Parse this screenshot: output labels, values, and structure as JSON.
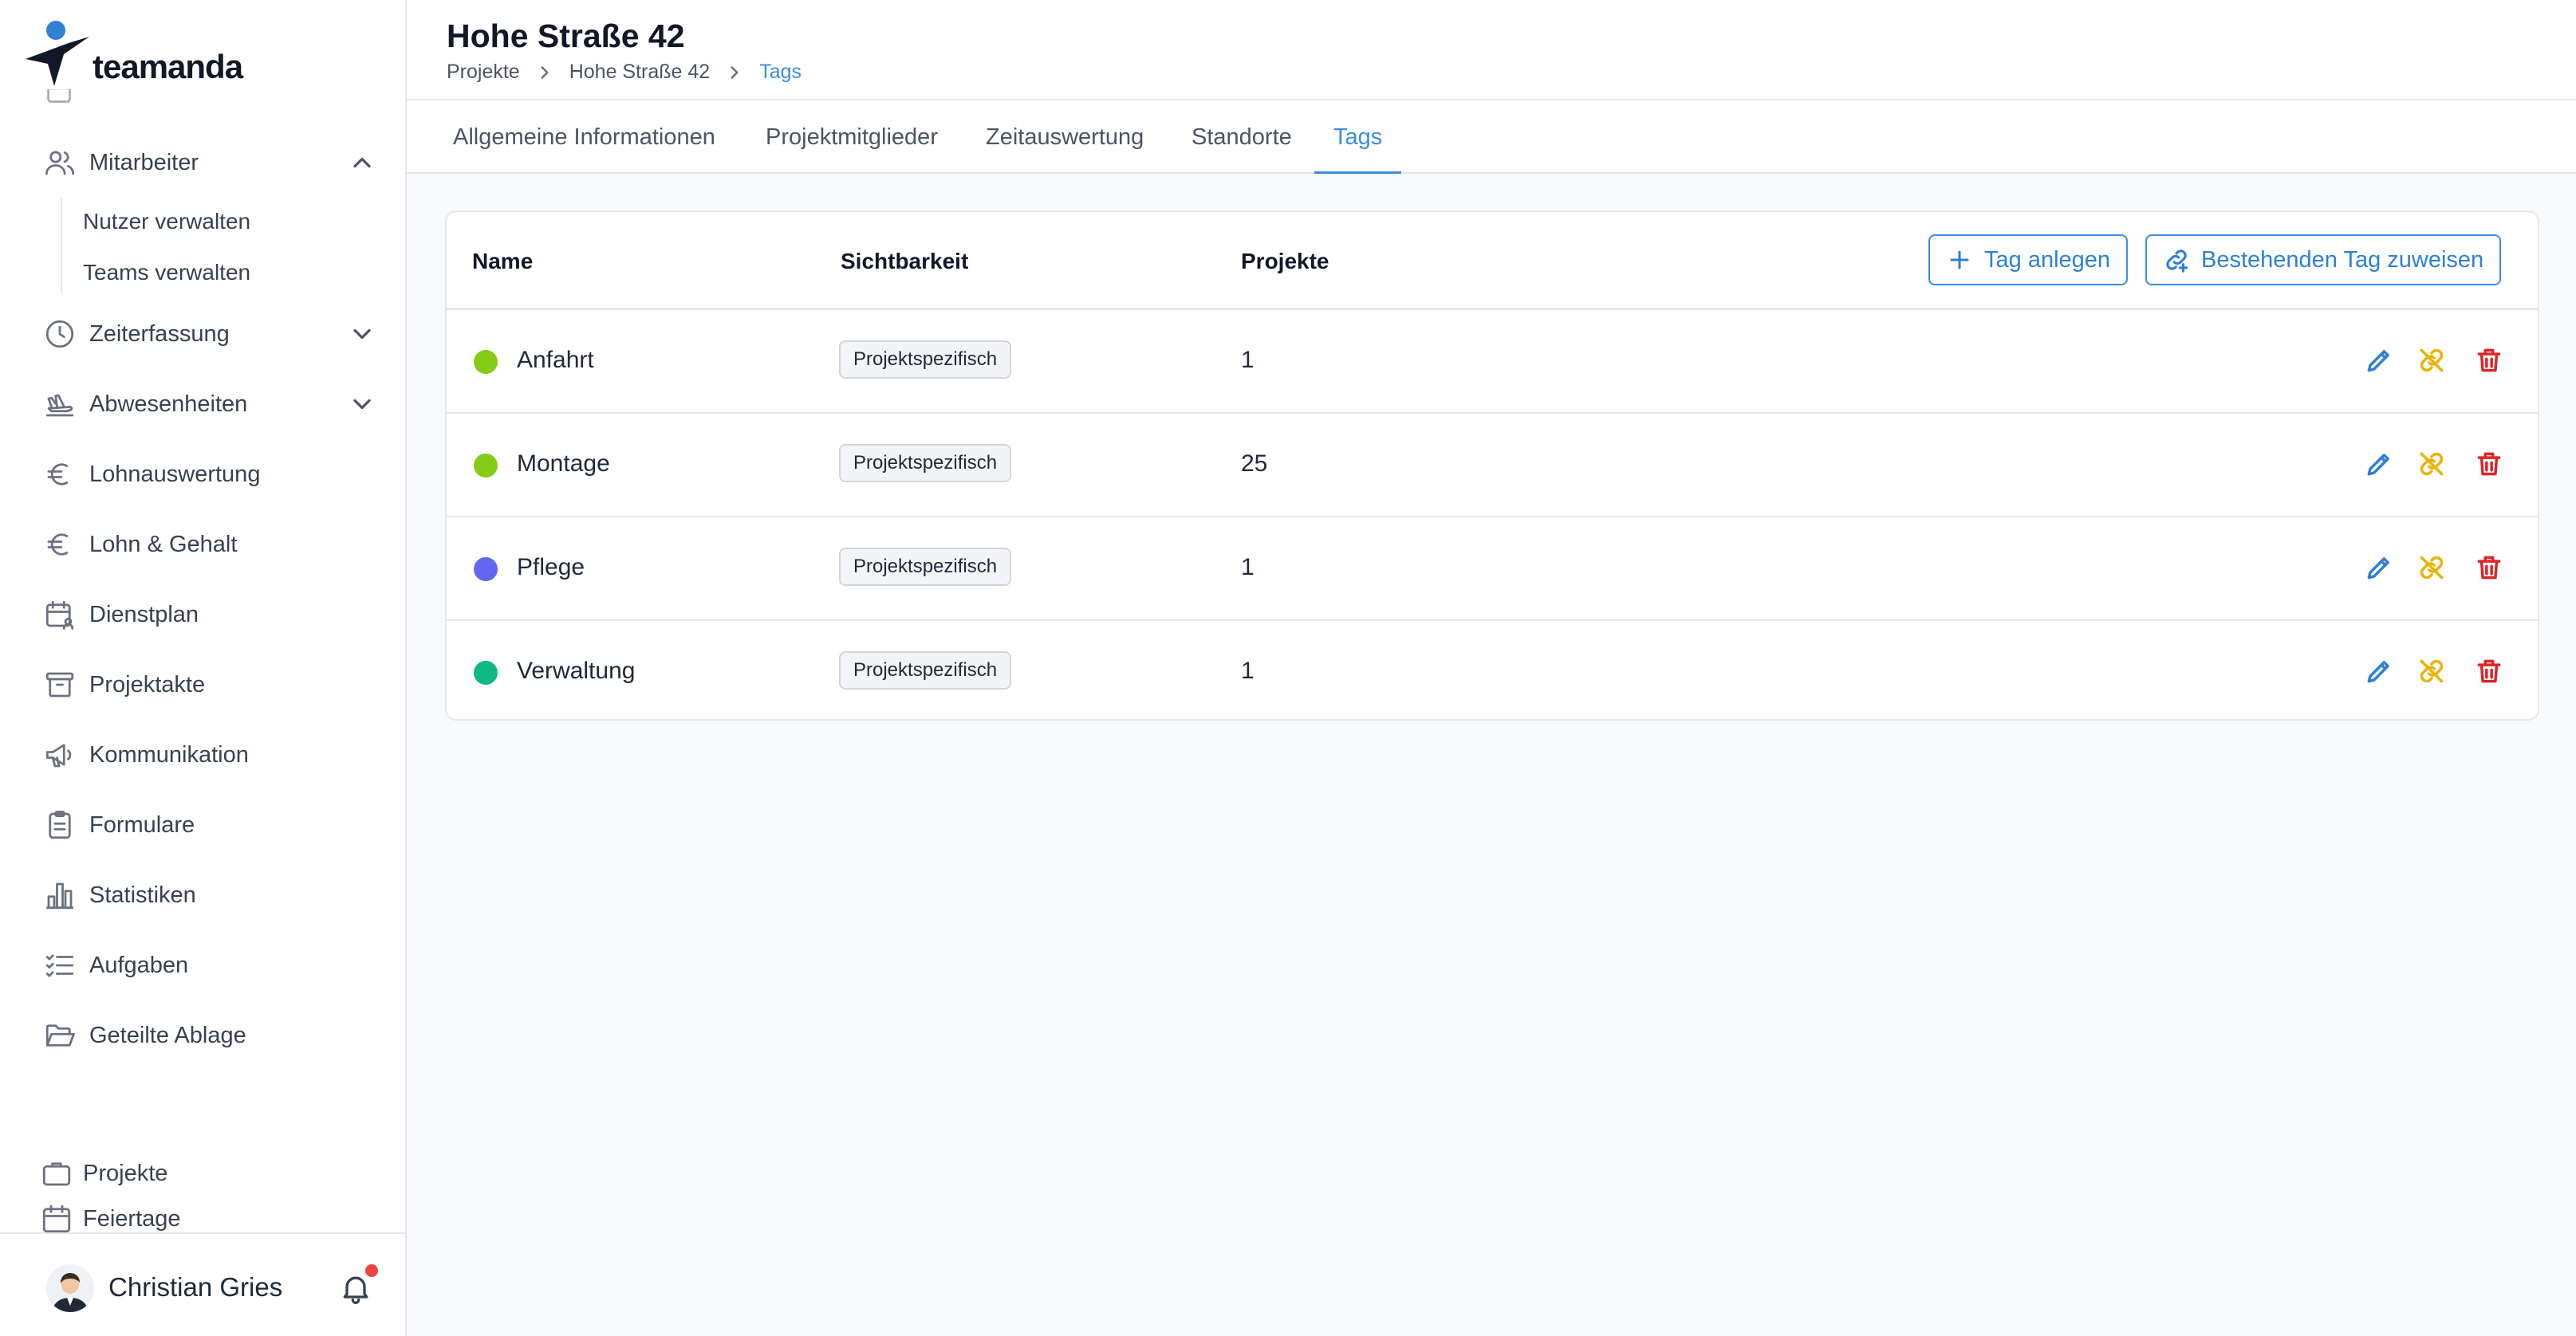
{
  "app": {
    "brand": "teamanda"
  },
  "sidebar": {
    "items": [
      {
        "label": "Mitarbeiter",
        "icon": "users-icon",
        "expanded": true
      },
      {
        "label": "Zeiterfassung",
        "icon": "clock-icon",
        "expanded": false
      },
      {
        "label": "Abwesenheiten",
        "icon": "plane-icon",
        "expanded": false
      },
      {
        "label": "Lohnauswertung",
        "icon": "euro-icon"
      },
      {
        "label": "Lohn & Gehalt",
        "icon": "euro-icon"
      },
      {
        "label": "Dienstplan",
        "icon": "calendar-user-icon"
      },
      {
        "label": "Projektakte",
        "icon": "archive-icon"
      },
      {
        "label": "Kommunikation",
        "icon": "megaphone-icon"
      },
      {
        "label": "Formulare",
        "icon": "clipboard-icon"
      },
      {
        "label": "Statistiken",
        "icon": "bar-chart-icon"
      },
      {
        "label": "Aufgaben",
        "icon": "checklist-icon"
      },
      {
        "label": "Geteilte Ablage",
        "icon": "folder-open-icon"
      }
    ],
    "subitems": [
      "Nutzer verwalten",
      "Teams verwalten"
    ],
    "bottom_items": [
      {
        "label": "Projekte",
        "icon": "briefcase-icon"
      },
      {
        "label": "Feiertage",
        "icon": "calendar-icon"
      }
    ],
    "user": {
      "name": "Christian Gries",
      "has_notification": true
    }
  },
  "header": {
    "title": "Hohe Straße 42",
    "breadcrumb": [
      "Projekte",
      "Hohe Straße 42",
      "Tags"
    ]
  },
  "tabs": [
    {
      "label": "Allgemeine Informationen",
      "active": false
    },
    {
      "label": "Projektmitglieder",
      "active": false
    },
    {
      "label": "Zeitauswertung",
      "active": false
    },
    {
      "label": "Standorte",
      "active": false
    },
    {
      "label": "Tags",
      "active": true
    }
  ],
  "table": {
    "columns": [
      "Name",
      "Sichtbarkeit",
      "Projekte"
    ],
    "buttons": {
      "create": "Tag anlegen",
      "assign": "Bestehenden Tag zuweisen"
    },
    "rows": [
      {
        "name": "Anfahrt",
        "color": "#84cc16",
        "visibility": "Projektspezifisch",
        "projects": "1"
      },
      {
        "name": "Montage",
        "color": "#84cc16",
        "visibility": "Projektspezifisch",
        "projects": "25"
      },
      {
        "name": "Pflege",
        "color": "#6366f1",
        "visibility": "Projektspezifisch",
        "projects": "1"
      },
      {
        "name": "Verwaltung",
        "color": "#10b981",
        "visibility": "Projektspezifisch",
        "projects": "1"
      }
    ]
  },
  "colors": {
    "accent": "#3b8ede",
    "edit": "#2f80d6",
    "unlink": "#eab308",
    "delete": "#dc2626",
    "notification": "#ef4444"
  }
}
